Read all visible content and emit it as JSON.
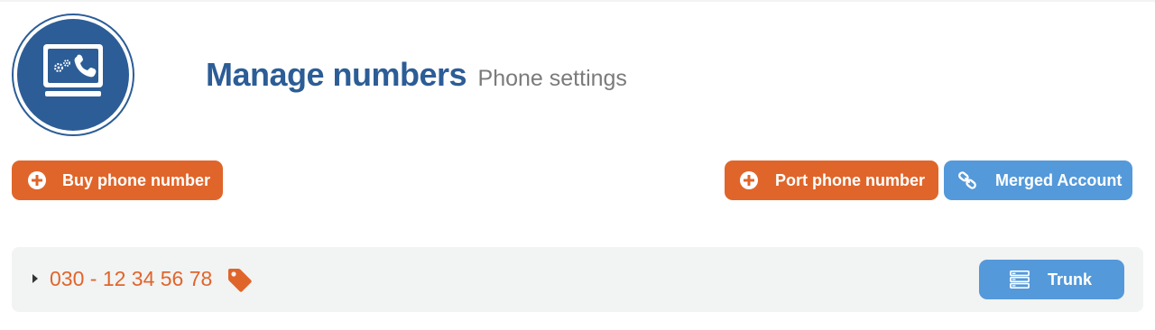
{
  "header": {
    "title": "Manage numbers",
    "subtitle": "Phone settings",
    "logo_icon": "computer-phone-settings-icon"
  },
  "actions": {
    "buy_label": "Buy phone number",
    "port_label": "Port phone number",
    "merged_label": "Merged Account"
  },
  "numbers": [
    {
      "number": "030 - 12 34 56 78",
      "trunk_label": "Trunk"
    }
  ],
  "colors": {
    "brand_blue": "#2c5d96",
    "orange": "#e0652a",
    "light_blue": "#5499da",
    "row_bg": "#f2f3f3",
    "subtitle_gray": "#7b7b7b"
  }
}
